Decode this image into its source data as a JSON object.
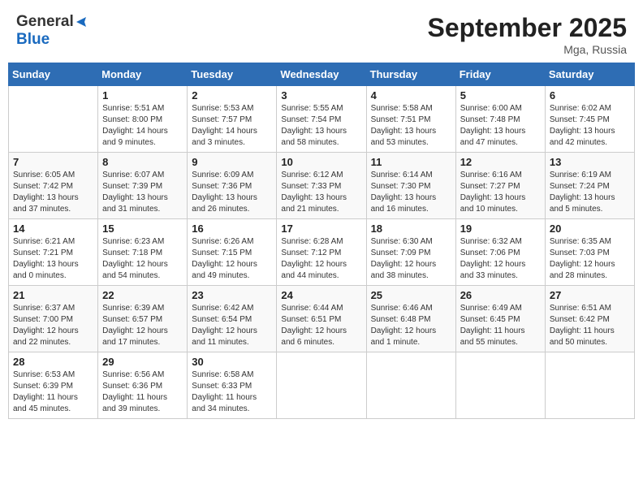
{
  "logo": {
    "general": "General",
    "blue": "Blue"
  },
  "title": "September 2025",
  "location": "Mga, Russia",
  "days_of_week": [
    "Sunday",
    "Monday",
    "Tuesday",
    "Wednesday",
    "Thursday",
    "Friday",
    "Saturday"
  ],
  "weeks": [
    [
      {
        "day": "",
        "info": ""
      },
      {
        "day": "1",
        "info": "Sunrise: 5:51 AM\nSunset: 8:00 PM\nDaylight: 14 hours\nand 9 minutes."
      },
      {
        "day": "2",
        "info": "Sunrise: 5:53 AM\nSunset: 7:57 PM\nDaylight: 14 hours\nand 3 minutes."
      },
      {
        "day": "3",
        "info": "Sunrise: 5:55 AM\nSunset: 7:54 PM\nDaylight: 13 hours\nand 58 minutes."
      },
      {
        "day": "4",
        "info": "Sunrise: 5:58 AM\nSunset: 7:51 PM\nDaylight: 13 hours\nand 53 minutes."
      },
      {
        "day": "5",
        "info": "Sunrise: 6:00 AM\nSunset: 7:48 PM\nDaylight: 13 hours\nand 47 minutes."
      },
      {
        "day": "6",
        "info": "Sunrise: 6:02 AM\nSunset: 7:45 PM\nDaylight: 13 hours\nand 42 minutes."
      }
    ],
    [
      {
        "day": "7",
        "info": "Sunrise: 6:05 AM\nSunset: 7:42 PM\nDaylight: 13 hours\nand 37 minutes."
      },
      {
        "day": "8",
        "info": "Sunrise: 6:07 AM\nSunset: 7:39 PM\nDaylight: 13 hours\nand 31 minutes."
      },
      {
        "day": "9",
        "info": "Sunrise: 6:09 AM\nSunset: 7:36 PM\nDaylight: 13 hours\nand 26 minutes."
      },
      {
        "day": "10",
        "info": "Sunrise: 6:12 AM\nSunset: 7:33 PM\nDaylight: 13 hours\nand 21 minutes."
      },
      {
        "day": "11",
        "info": "Sunrise: 6:14 AM\nSunset: 7:30 PM\nDaylight: 13 hours\nand 16 minutes."
      },
      {
        "day": "12",
        "info": "Sunrise: 6:16 AM\nSunset: 7:27 PM\nDaylight: 13 hours\nand 10 minutes."
      },
      {
        "day": "13",
        "info": "Sunrise: 6:19 AM\nSunset: 7:24 PM\nDaylight: 13 hours\nand 5 minutes."
      }
    ],
    [
      {
        "day": "14",
        "info": "Sunrise: 6:21 AM\nSunset: 7:21 PM\nDaylight: 13 hours\nand 0 minutes."
      },
      {
        "day": "15",
        "info": "Sunrise: 6:23 AM\nSunset: 7:18 PM\nDaylight: 12 hours\nand 54 minutes."
      },
      {
        "day": "16",
        "info": "Sunrise: 6:26 AM\nSunset: 7:15 PM\nDaylight: 12 hours\nand 49 minutes."
      },
      {
        "day": "17",
        "info": "Sunrise: 6:28 AM\nSunset: 7:12 PM\nDaylight: 12 hours\nand 44 minutes."
      },
      {
        "day": "18",
        "info": "Sunrise: 6:30 AM\nSunset: 7:09 PM\nDaylight: 12 hours\nand 38 minutes."
      },
      {
        "day": "19",
        "info": "Sunrise: 6:32 AM\nSunset: 7:06 PM\nDaylight: 12 hours\nand 33 minutes."
      },
      {
        "day": "20",
        "info": "Sunrise: 6:35 AM\nSunset: 7:03 PM\nDaylight: 12 hours\nand 28 minutes."
      }
    ],
    [
      {
        "day": "21",
        "info": "Sunrise: 6:37 AM\nSunset: 7:00 PM\nDaylight: 12 hours\nand 22 minutes."
      },
      {
        "day": "22",
        "info": "Sunrise: 6:39 AM\nSunset: 6:57 PM\nDaylight: 12 hours\nand 17 minutes."
      },
      {
        "day": "23",
        "info": "Sunrise: 6:42 AM\nSunset: 6:54 PM\nDaylight: 12 hours\nand 11 minutes."
      },
      {
        "day": "24",
        "info": "Sunrise: 6:44 AM\nSunset: 6:51 PM\nDaylight: 12 hours\nand 6 minutes."
      },
      {
        "day": "25",
        "info": "Sunrise: 6:46 AM\nSunset: 6:48 PM\nDaylight: 12 hours\nand 1 minute."
      },
      {
        "day": "26",
        "info": "Sunrise: 6:49 AM\nSunset: 6:45 PM\nDaylight: 11 hours\nand 55 minutes."
      },
      {
        "day": "27",
        "info": "Sunrise: 6:51 AM\nSunset: 6:42 PM\nDaylight: 11 hours\nand 50 minutes."
      }
    ],
    [
      {
        "day": "28",
        "info": "Sunrise: 6:53 AM\nSunset: 6:39 PM\nDaylight: 11 hours\nand 45 minutes."
      },
      {
        "day": "29",
        "info": "Sunrise: 6:56 AM\nSunset: 6:36 PM\nDaylight: 11 hours\nand 39 minutes."
      },
      {
        "day": "30",
        "info": "Sunrise: 6:58 AM\nSunset: 6:33 PM\nDaylight: 11 hours\nand 34 minutes."
      },
      {
        "day": "",
        "info": ""
      },
      {
        "day": "",
        "info": ""
      },
      {
        "day": "",
        "info": ""
      },
      {
        "day": "",
        "info": ""
      }
    ]
  ]
}
